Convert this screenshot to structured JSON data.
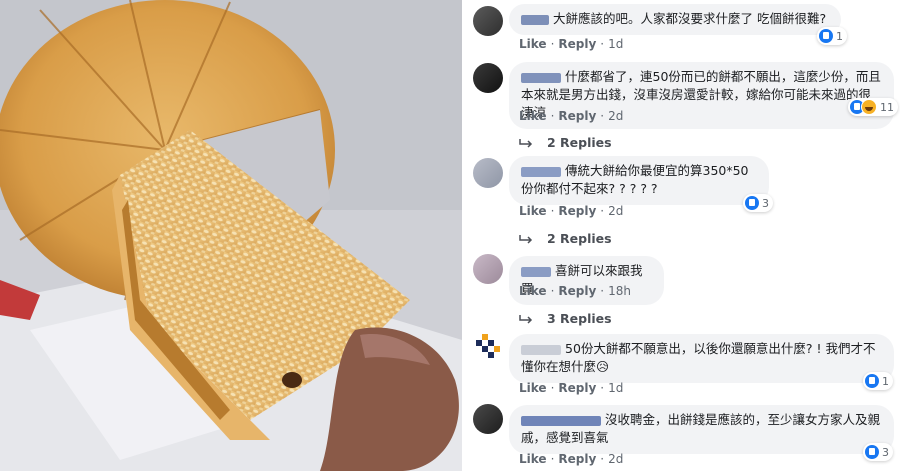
{
  "photo": {
    "alt": "sesame wedding cake slice"
  },
  "comments": [
    {
      "text": "大餅應該的吧。人家都沒要求什麼了 吃個餅很難?",
      "like": "Like",
      "reply": "Reply",
      "time": "1d",
      "reaction_count": "1",
      "reactions": [
        "like-icon"
      ]
    },
    {
      "text": "什麼都省了，連50份而已的餅都不願出，這麼少份，而且本來就是男方出錢，沒車沒房還愛計較，嫁給你可能未來過的很淒涼",
      "like": "Like",
      "reply": "Reply",
      "time": "2d",
      "reaction_count": "11",
      "reactions": [
        "like-icon",
        "haha-icon"
      ],
      "replies": "2 Replies"
    },
    {
      "text": "傳統大餅給你最便宜的算350*50份你都付不起來? ? ? ? ?",
      "like": "Like",
      "reply": "Reply",
      "time": "2d",
      "reaction_count": "3",
      "reactions": [
        "like-icon"
      ],
      "replies": "2 Replies"
    },
    {
      "text": "喜餅可以來跟我買",
      "like": "Like",
      "reply": "Reply",
      "time": "18h",
      "replies": "3 Replies"
    },
    {
      "text": "50份大餅都不願意出，以後你還願意出什麼? ! 我們才不懂你在想什麼😥",
      "like": "Like",
      "reply": "Reply",
      "time": "1d",
      "reaction_count": "1",
      "reactions": [
        "like-icon"
      ]
    },
    {
      "text": "沒收聘金，出餅錢是應該的，至少讓女方家人及親戚，感覺到喜氣",
      "like": "Like",
      "reply": "Reply",
      "time": "2d",
      "reaction_count": "3",
      "reactions": [
        "like-icon"
      ]
    }
  ],
  "colors": {
    "bubble": "#f2f3f5",
    "link": "#606770",
    "like_blue": "#1877f2",
    "haha_yellow": "#f7b125"
  }
}
